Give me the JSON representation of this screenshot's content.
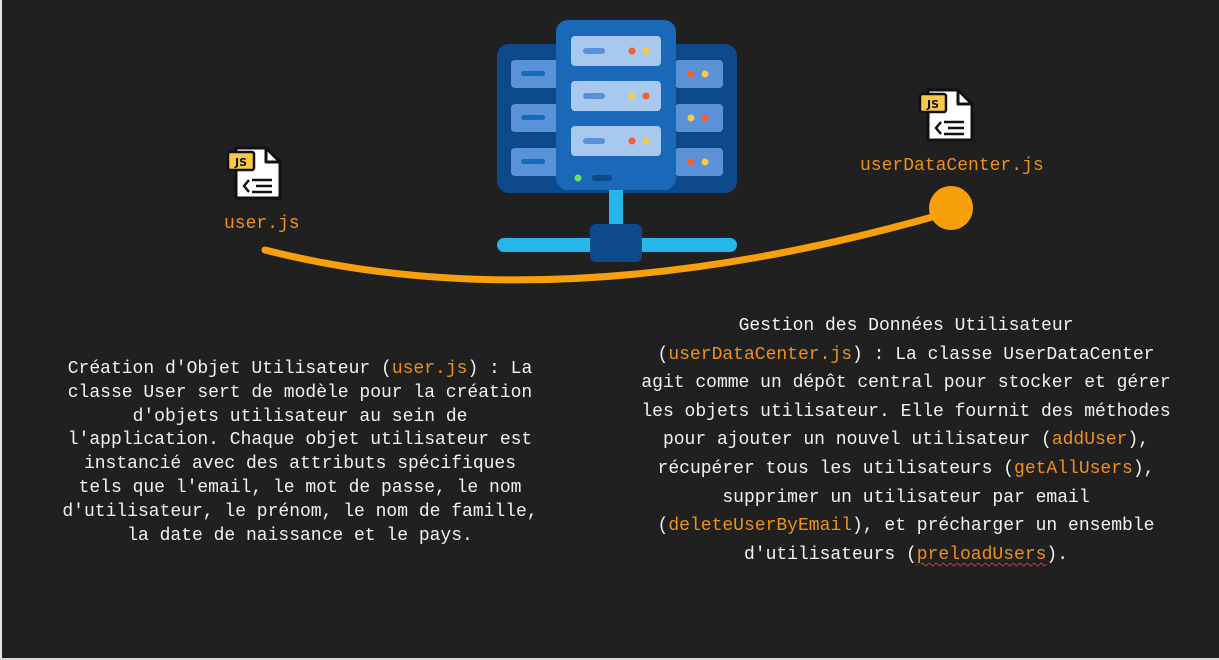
{
  "files": {
    "left": "user.js",
    "right": "userDataCenter.js",
    "icon_badge": "JS"
  },
  "colors": {
    "background": "#202020",
    "accent_orange": "#f0901a",
    "server_dark": "#0d4a8c",
    "server_mid": "#1a68b8",
    "server_light": "#a9c8ee",
    "network_cyan": "#25b6ea"
  },
  "left_desc": {
    "l1_a": "Création d'Objet Utilisateur (",
    "l1_code": "user.js",
    "l1_b": ") : La",
    "l2": "classe User sert de modèle pour la création",
    "l3": "d'objets utilisateur au sein de",
    "l4": "l'application. Chaque objet utilisateur est",
    "l5": "instancié avec des attributs spécifiques",
    "l6": "tels que l'email, le mot de passe, le nom",
    "l7": "d'utilisateur, le prénom, le nom de famille,",
    "l8": "la date de naissance et le pays."
  },
  "right_desc": {
    "l1": "Gestion des Données Utilisateur",
    "l2_a": "(",
    "l2_code": "userDataCenter.js",
    "l2_b": ") : La classe UserDataCenter",
    "l3": "agit comme un dépôt central pour stocker et gérer",
    "l4": "les objets utilisateur. Elle fournit des méthodes",
    "l5_a": "pour ajouter un nouvel utilisateur (",
    "l5_code": "addUser",
    "l5_b": "),",
    "l6_a": "récupérer tous les utilisateurs (",
    "l6_code": "getAllUsers",
    "l6_b": "),",
    "l7": "supprimer un utilisateur par email",
    "l8_a": "(",
    "l8_code": "deleteUserByEmail",
    "l8_b": "), et précharger un ensemble",
    "l9_a": "d'utilisateurs (",
    "l9_code": "preloadUsers",
    "l9_b": ")."
  }
}
